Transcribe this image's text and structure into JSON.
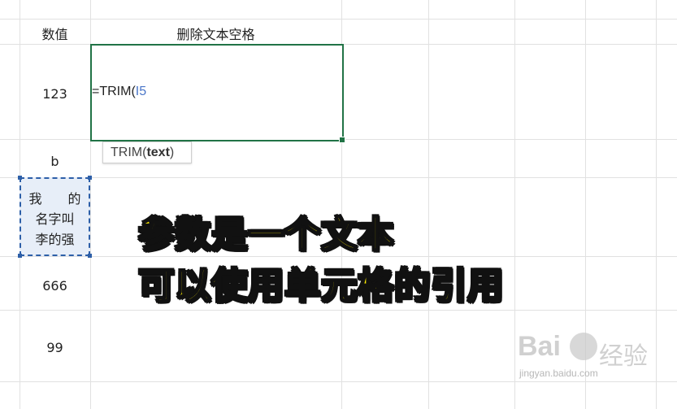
{
  "sheet": {
    "header_col_a": "数值",
    "header_col_b": "删除文本空格",
    "col_a_values": [
      "123",
      "b",
      "666",
      "99"
    ],
    "referenced_cell_lines": [
      "我　　的",
      "名字叫",
      "李的强"
    ]
  },
  "formula": {
    "prefix": "=TRIM(",
    "reference": "I5"
  },
  "tooltip": {
    "function_name": "TRIM(",
    "argument": "text",
    "suffix": ")"
  },
  "caption": {
    "line1": "参数是一个文本",
    "line2": "可以使用单元格的引用"
  },
  "watermark": {
    "logo": "Bai",
    "text": "经验",
    "url": "jingyan.baidu.com"
  },
  "colors": {
    "active_border": "#217346",
    "reference_border": "#2d5fa8",
    "reference_fill": "#e7eef8",
    "caption": "#ffee00",
    "reference_text": "#4a76c8"
  }
}
